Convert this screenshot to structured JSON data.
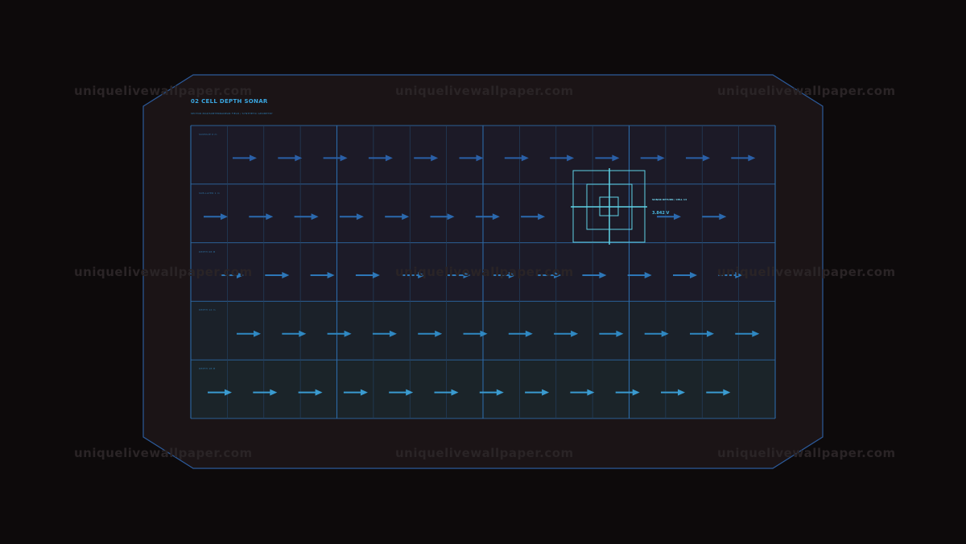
{
  "panel": {
    "title": "02  CELL DEPTH SONAR",
    "subtitle": "SECTOR MAP/SUBTERRANEAN FIELD / SYNTHETIC GEOMETRY",
    "rows": [
      {
        "label": "SURFACE 0 m",
        "color": "#2a5fa6"
      },
      {
        "label": "SUB-LAYER 1 m",
        "color": "#2b69ae"
      },
      {
        "label": "DEPTH 08 M",
        "color": "#2d77b8"
      },
      {
        "label": "DEPTH 12 m",
        "color": "#2f88c2"
      },
      {
        "label": "DEPTH 18 M",
        "color": "#3a9bd0"
      }
    ],
    "colors": {
      "grid_line": "#2b5f95",
      "accent": "#3aa6e0",
      "target": "#5fd2e6",
      "frame": "#2c5a9a"
    }
  },
  "target": {
    "label": "SONAR RETURN / CELL 14",
    "value": "3.842 V"
  },
  "watermark": "uniquelivewallpaper.com"
}
